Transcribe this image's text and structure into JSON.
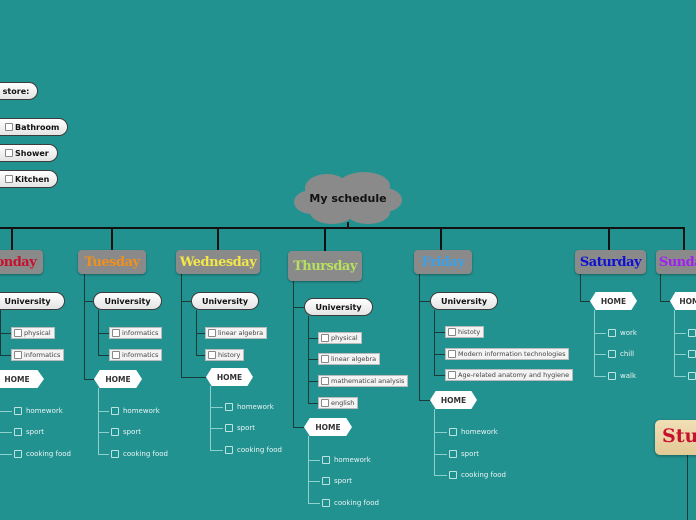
{
  "central_topic": "My schedule",
  "restore_panel": {
    "title": "store:",
    "items": [
      "Bathroom",
      "Shower",
      "Kitchen"
    ]
  },
  "days": [
    {
      "name": "Monday",
      "color": "#c8102e",
      "university": "University",
      "university_items": [
        "physical",
        "informatics"
      ],
      "home": "HOME",
      "home_items": [
        "homework",
        "sport",
        "cooking food"
      ]
    },
    {
      "name": "Tuesday",
      "color": "#f0901e",
      "university": "University",
      "university_items": [
        "informatics",
        "informatics"
      ],
      "home": "HOME",
      "home_items": [
        "homework",
        "sport",
        "cooking food"
      ]
    },
    {
      "name": "Wednesday",
      "color": "#f2e64a",
      "university": "University",
      "university_items": [
        "linear algebra",
        "history"
      ],
      "home": "HOME",
      "home_items": [
        "homework",
        "sport",
        "cooking food"
      ]
    },
    {
      "name": "Thursday",
      "color": "#b8e060",
      "university": "University",
      "university_items": [
        "physical",
        "linear algebra",
        "mathematical analysis",
        "english"
      ],
      "home": "HOME",
      "home_items": [
        "homework",
        "sport",
        "cooking food"
      ]
    },
    {
      "name": "Friday",
      "color": "#3aa0e8",
      "university": "University",
      "university_items": [
        "histoty",
        "Modern information technologies",
        "Age-related anatomy and hygiene"
      ],
      "home": "HOME",
      "home_items": [
        "homework",
        "sport",
        "cooking food"
      ]
    },
    {
      "name": "Saturday",
      "color": "#1010d0",
      "home": "HOME",
      "home_items": [
        "work",
        "chill",
        "walk"
      ]
    },
    {
      "name": "Sunday",
      "color": "#a020f0",
      "home": "HOME",
      "home_items": [
        "",
        "",
        ""
      ]
    }
  ],
  "studying_topic": {
    "label": "Studying",
    "color": "#c8102e"
  }
}
